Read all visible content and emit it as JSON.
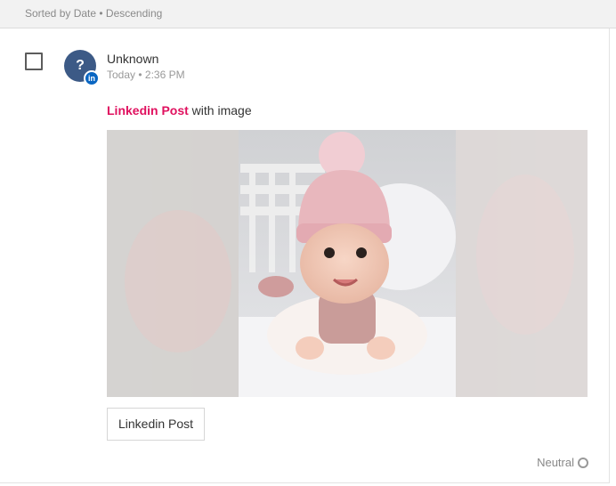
{
  "sort": {
    "label": "Sorted by Date • Descending"
  },
  "post": {
    "author": "Unknown",
    "avatar_initial": "?",
    "network_badge": "in",
    "time": "Today • 2:36 PM",
    "caption_source": "Linkedin Post",
    "caption_suffix": " with image",
    "image_icon": "baby-photo",
    "link_label": "Linkedin Post",
    "sentiment": "Neutral"
  },
  "colors": {
    "brand_pink": "#e0115f",
    "avatar_blue": "#3c5a86",
    "linkedin_blue": "#0a66c2"
  }
}
